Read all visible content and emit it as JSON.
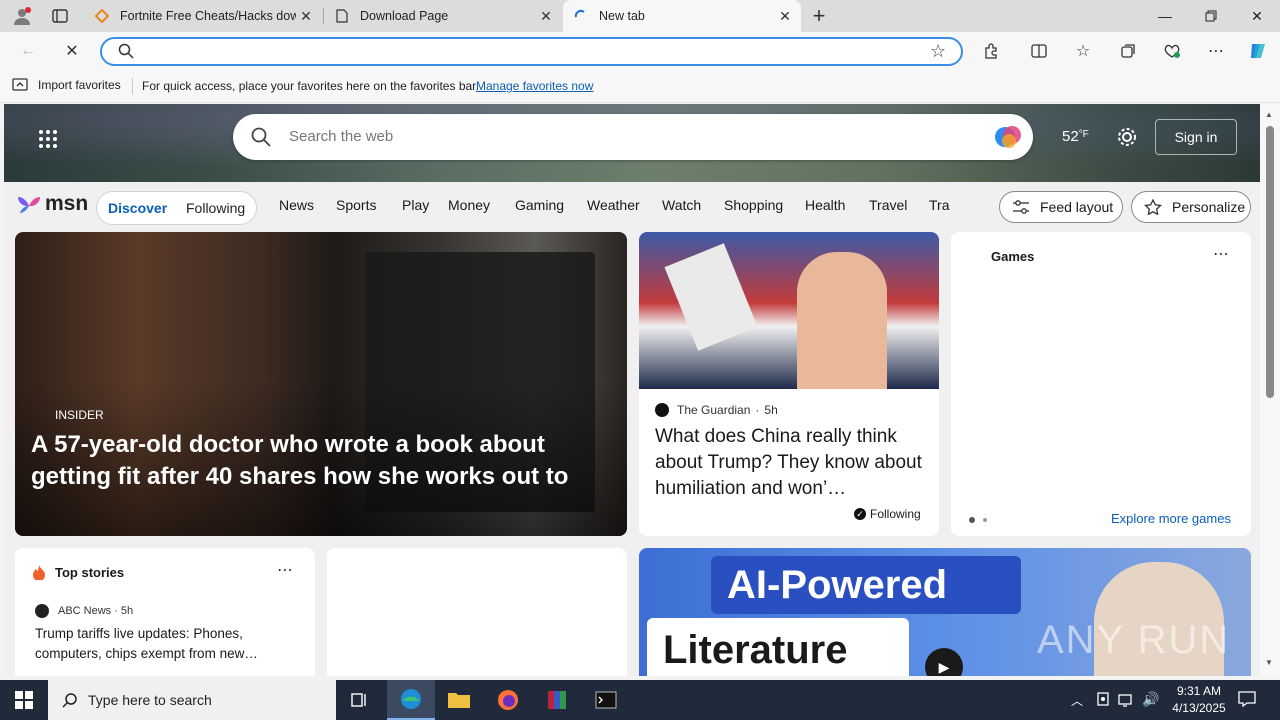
{
  "tabs": [
    {
      "title": "Fortnite Free Cheats/Hacks down",
      "icon": "fortnite-icon"
    },
    {
      "title": "Download Page",
      "icon": "page-icon"
    },
    {
      "title": "New tab",
      "icon": "loading-icon"
    }
  ],
  "favorites_bar": {
    "import_label": "Import favorites",
    "message": "For quick access, place your favorites here on the favorites bar.",
    "manage_link": "Manage favorites now"
  },
  "msn": {
    "search_placeholder": "Search the web",
    "temperature": "52",
    "temp_unit": "°F",
    "sign_in": "Sign in",
    "logo": "msn",
    "pills": [
      "Discover",
      "Following"
    ],
    "nav": [
      "News",
      "Sports",
      "Play",
      "Money",
      "Gaming",
      "Weather",
      "Watch",
      "Shopping",
      "Health",
      "Travel",
      "Tra"
    ],
    "feed_layout": "Feed layout",
    "personalize": "Personalize"
  },
  "hero_story": {
    "source": "INSIDER",
    "headline": "A 57-year-old doctor who wrote a book about getting fit after 40 shares how she works out to sta…"
  },
  "story2": {
    "source": "The Guardian",
    "age": "5h",
    "headline": "What does China really think about Trump? They know about humiliation and won’…",
    "following": "Following"
  },
  "games": {
    "title": "Games",
    "explore": "Explore more games"
  },
  "top_stories": {
    "title": "Top stories",
    "source": "ABC News",
    "age": "5h",
    "headline": "Trump tariffs live updates: Phones, computers, chips exempt from new…"
  },
  "ad": {
    "line1": "AI-Powered",
    "line2": "Literature",
    "watermark": "ANY RUN"
  },
  "taskbar": {
    "search_placeholder": "Type here to search",
    "time": "9:31 AM",
    "date": "4/13/2025"
  }
}
